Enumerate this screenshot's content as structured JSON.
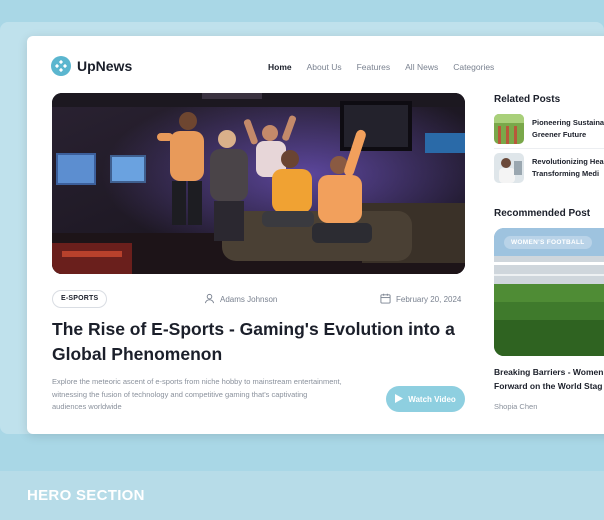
{
  "brand": {
    "name": "UpNews"
  },
  "nav": {
    "items": [
      "Home",
      "About Us",
      "Features",
      "All News",
      "Categories"
    ]
  },
  "article": {
    "tag": "E-SPORTS",
    "author": "Adams Johnson",
    "date": "February 20, 2024",
    "title": "The Rise of E-Sports - Gaming's Evolution into a Global Phenomenon",
    "description": "Explore the meteoric ascent of e-sports from niche hobby to mainstream entertainment, witnessing the fusion of technology and competitive gaming that's captivating audiences worldwide",
    "watch_label": "Watch Video"
  },
  "related": {
    "heading": "Related Posts",
    "items": [
      {
        "line1": "Pioneering Sustaina",
        "line2": "Greener Future"
      },
      {
        "line1": "Revolutionizing Hea",
        "line2": "Transforming Medi"
      }
    ]
  },
  "recommended": {
    "heading": "Recommended Post",
    "badge": "WOMEN'S FOOTBALL",
    "title_line1": "Breaking Barriers - Women",
    "title_line2": "Forward on the World Stag",
    "author": "Shopia Chen"
  },
  "section_label": "HERO SECTION",
  "colors": {
    "accent": "#5bb6cf",
    "button": "#8ecfe0",
    "background": "#a9d7e6"
  }
}
